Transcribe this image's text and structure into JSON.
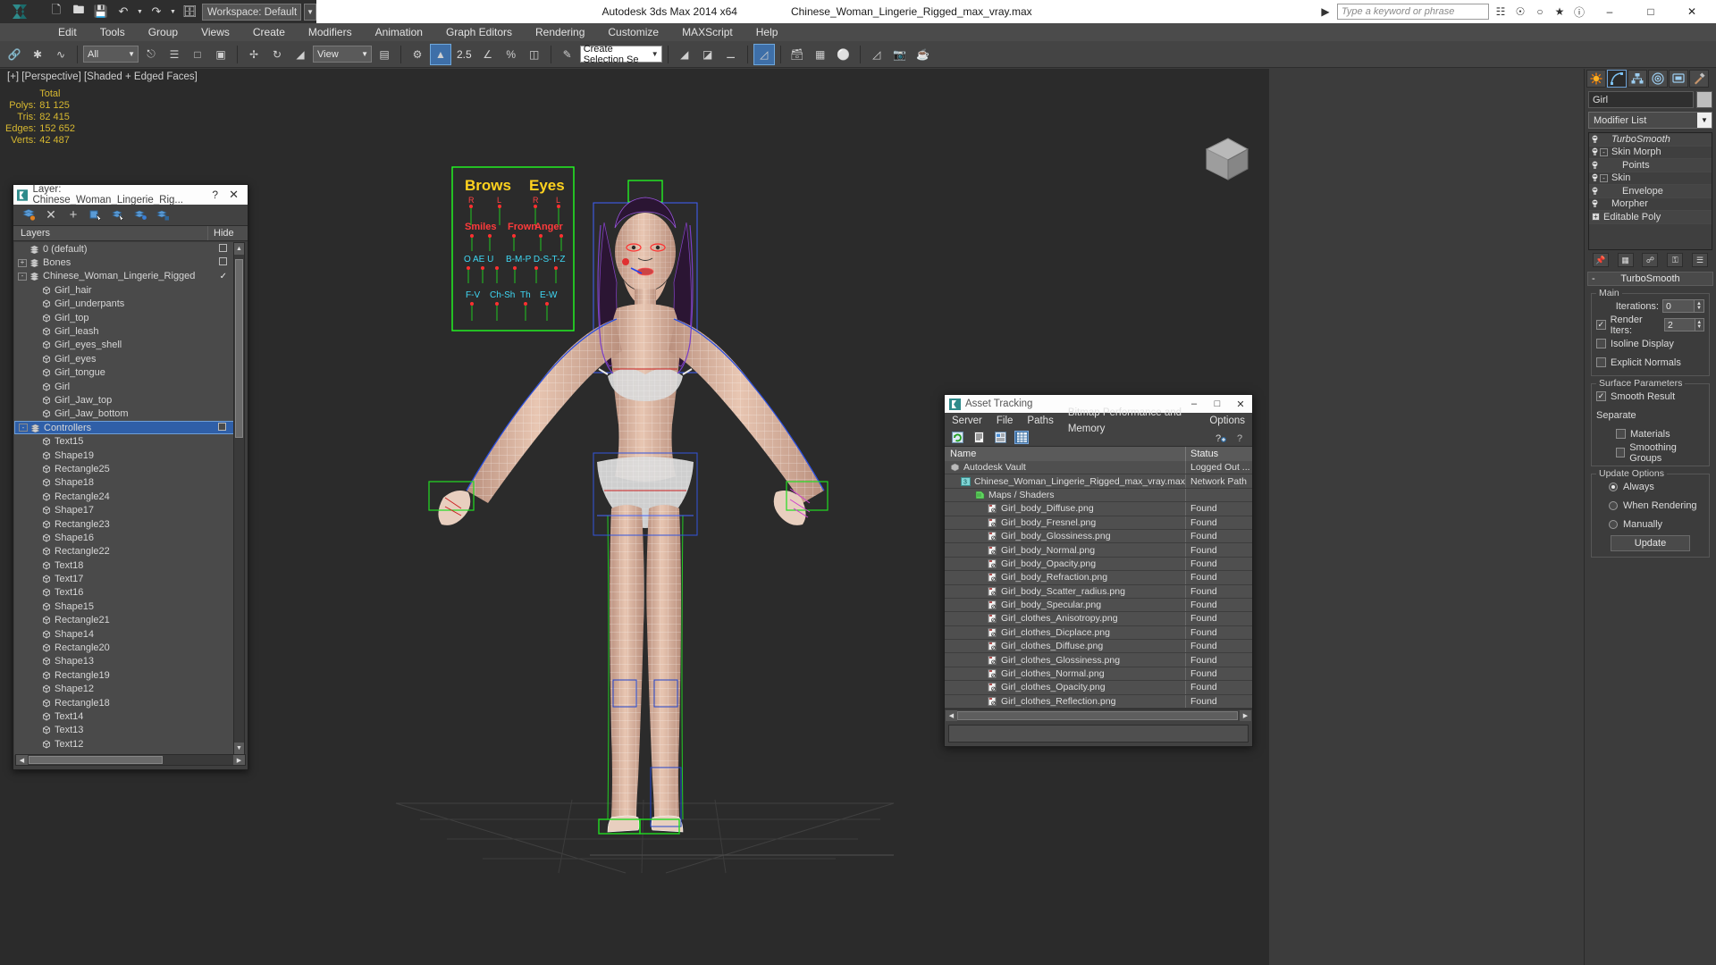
{
  "titlebar": {
    "app_title": "Autodesk 3ds Max  2014 x64",
    "file_title": "Chinese_Woman_Lingerie_Rigged_max_vray.max",
    "workspace": "Workspace: Default",
    "search_placeholder": "Type a keyword or phrase",
    "quick_icons": [
      "new-icon",
      "open-icon",
      "save-icon",
      "undo-icon",
      "redo-icon",
      "set-project-icon"
    ],
    "window_buttons": [
      "minimize",
      "maximize",
      "close"
    ]
  },
  "menubar": {
    "items": [
      "Edit",
      "Tools",
      "Group",
      "Views",
      "Create",
      "Modifiers",
      "Animation",
      "Graph Editors",
      "Rendering",
      "Customize",
      "MAXScript",
      "Help"
    ]
  },
  "toolbar": {
    "selection_filter": "All",
    "reference_coord": "View",
    "named_selection_set": "Create Selection Se",
    "angle_snap_value": "2.5"
  },
  "viewport": {
    "label": "[+] [Perspective] [Shaded + Edged Faces]",
    "stats": {
      "header": "Total",
      "rows": [
        {
          "label": "Polys:",
          "value": "81 125"
        },
        {
          "label": "Tris:",
          "value": "82 415"
        },
        {
          "label": "Edges:",
          "value": "152 652"
        },
        {
          "label": "Verts:",
          "value": "42 487"
        }
      ]
    },
    "overlay_labels": {
      "brows": "Brows",
      "eyes": "Eyes",
      "smiles": "Smiles",
      "frown": "Frown",
      "anger": "Anger",
      "left_short": "L",
      "right_short": "R",
      "row3": "O  AE  U",
      "row3b": "B-M-P  D-S-T-Z",
      "row4": "F-V",
      "row4b": "Ch-Sh",
      "row4c": "Th",
      "row4d": "E-W"
    }
  },
  "layer_dialog": {
    "title": "Layer: Chinese_Woman_Lingerie_Rig...",
    "help_label": "?",
    "close_label": "✕",
    "toolbar_icons": [
      "new-layer-icon",
      "delete-layer-icon",
      "add-layer-icon",
      "select-objects-icon",
      "select-highlighted-icon",
      "add-selection-icon",
      "layer-properties-icon"
    ],
    "columns": {
      "name": "Layers",
      "hide": "Hide"
    },
    "rows": [
      {
        "label": "0 (default)",
        "indent": 1,
        "icon": "layer-icon",
        "expander": null,
        "hide": "box",
        "selected": false
      },
      {
        "label": "Bones",
        "indent": 1,
        "icon": "layer-icon",
        "expander": "+",
        "hide": "box",
        "selected": false
      },
      {
        "label": "Chinese_Woman_Lingerie_Rigged",
        "indent": 1,
        "icon": "layer-icon",
        "expander": "-",
        "hide": "check",
        "selected": false
      },
      {
        "label": "Girl_hair",
        "indent": 2,
        "icon": "object-icon",
        "expander": null,
        "hide": "",
        "selected": false
      },
      {
        "label": "Girl_underpants",
        "indent": 2,
        "icon": "object-icon",
        "expander": null,
        "hide": "",
        "selected": false
      },
      {
        "label": "Girl_top",
        "indent": 2,
        "icon": "object-icon",
        "expander": null,
        "hide": "",
        "selected": false
      },
      {
        "label": "Girl_leash",
        "indent": 2,
        "icon": "object-icon",
        "expander": null,
        "hide": "",
        "selected": false
      },
      {
        "label": "Girl_eyes_shell",
        "indent": 2,
        "icon": "object-icon",
        "expander": null,
        "hide": "",
        "selected": false
      },
      {
        "label": "Girl_eyes",
        "indent": 2,
        "icon": "object-icon",
        "expander": null,
        "hide": "",
        "selected": false
      },
      {
        "label": "Girl_tongue",
        "indent": 2,
        "icon": "object-icon",
        "expander": null,
        "hide": "",
        "selected": false
      },
      {
        "label": "Girl",
        "indent": 2,
        "icon": "object-icon",
        "expander": null,
        "hide": "",
        "selected": false
      },
      {
        "label": "Girl_Jaw_top",
        "indent": 2,
        "icon": "object-icon",
        "expander": null,
        "hide": "",
        "selected": false
      },
      {
        "label": "Girl_Jaw_bottom",
        "indent": 2,
        "icon": "object-icon",
        "expander": null,
        "hide": "",
        "selected": false
      },
      {
        "label": "Controllers",
        "indent": 1,
        "icon": "layer-icon",
        "expander": "-",
        "hide": "box",
        "selected": true
      },
      {
        "label": "Text15",
        "indent": 2,
        "icon": "object-icon",
        "expander": null,
        "hide": "",
        "selected": false
      },
      {
        "label": "Shape19",
        "indent": 2,
        "icon": "object-icon",
        "expander": null,
        "hide": "",
        "selected": false
      },
      {
        "label": "Rectangle25",
        "indent": 2,
        "icon": "object-icon",
        "expander": null,
        "hide": "",
        "selected": false
      },
      {
        "label": "Shape18",
        "indent": 2,
        "icon": "object-icon",
        "expander": null,
        "hide": "",
        "selected": false
      },
      {
        "label": "Rectangle24",
        "indent": 2,
        "icon": "object-icon",
        "expander": null,
        "hide": "",
        "selected": false
      },
      {
        "label": "Shape17",
        "indent": 2,
        "icon": "object-icon",
        "expander": null,
        "hide": "",
        "selected": false
      },
      {
        "label": "Rectangle23",
        "indent": 2,
        "icon": "object-icon",
        "expander": null,
        "hide": "",
        "selected": false
      },
      {
        "label": "Shape16",
        "indent": 2,
        "icon": "object-icon",
        "expander": null,
        "hide": "",
        "selected": false
      },
      {
        "label": "Rectangle22",
        "indent": 2,
        "icon": "object-icon",
        "expander": null,
        "hide": "",
        "selected": false
      },
      {
        "label": "Text18",
        "indent": 2,
        "icon": "object-icon",
        "expander": null,
        "hide": "",
        "selected": false
      },
      {
        "label": "Text17",
        "indent": 2,
        "icon": "object-icon",
        "expander": null,
        "hide": "",
        "selected": false
      },
      {
        "label": "Text16",
        "indent": 2,
        "icon": "object-icon",
        "expander": null,
        "hide": "",
        "selected": false
      },
      {
        "label": "Shape15",
        "indent": 2,
        "icon": "object-icon",
        "expander": null,
        "hide": "",
        "selected": false
      },
      {
        "label": "Rectangle21",
        "indent": 2,
        "icon": "object-icon",
        "expander": null,
        "hide": "",
        "selected": false
      },
      {
        "label": "Shape14",
        "indent": 2,
        "icon": "object-icon",
        "expander": null,
        "hide": "",
        "selected": false
      },
      {
        "label": "Rectangle20",
        "indent": 2,
        "icon": "object-icon",
        "expander": null,
        "hide": "",
        "selected": false
      },
      {
        "label": "Shape13",
        "indent": 2,
        "icon": "object-icon",
        "expander": null,
        "hide": "",
        "selected": false
      },
      {
        "label": "Rectangle19",
        "indent": 2,
        "icon": "object-icon",
        "expander": null,
        "hide": "",
        "selected": false
      },
      {
        "label": "Shape12",
        "indent": 2,
        "icon": "object-icon",
        "expander": null,
        "hide": "",
        "selected": false
      },
      {
        "label": "Rectangle18",
        "indent": 2,
        "icon": "object-icon",
        "expander": null,
        "hide": "",
        "selected": false
      },
      {
        "label": "Text14",
        "indent": 2,
        "icon": "object-icon",
        "expander": null,
        "hide": "",
        "selected": false
      },
      {
        "label": "Text13",
        "indent": 2,
        "icon": "object-icon",
        "expander": null,
        "hide": "",
        "selected": false
      },
      {
        "label": "Text12",
        "indent": 2,
        "icon": "object-icon",
        "expander": null,
        "hide": "",
        "selected": false
      }
    ]
  },
  "asset_tracking": {
    "title": "Asset Tracking",
    "menu": [
      "Server",
      "File",
      "Paths",
      "Bitmap Performance and Memory",
      "Options"
    ],
    "toolbar_icons": [
      "refresh-icon",
      "list-view-icon",
      "detail-view-icon",
      "grid-view-icon",
      "add-help-icon",
      "help-icon"
    ],
    "columns": {
      "name": "Name",
      "status": "Status"
    },
    "rows": [
      {
        "name": "Autodesk Vault",
        "status": "Logged Out ...",
        "indent": 1,
        "icon": "vault-icon"
      },
      {
        "name": "Chinese_Woman_Lingerie_Rigged_max_vray.max",
        "status": "Network Path",
        "indent": 2,
        "icon": "max-file-icon"
      },
      {
        "name": "Maps / Shaders",
        "status": "",
        "indent": 3,
        "icon": "maps-icon"
      },
      {
        "name": "Girl_body_Diffuse.png",
        "status": "Found",
        "indent": 4,
        "icon": "bitmap-icon"
      },
      {
        "name": "Girl_body_Fresnel.png",
        "status": "Found",
        "indent": 4,
        "icon": "bitmap-icon"
      },
      {
        "name": "Girl_body_Glossiness.png",
        "status": "Found",
        "indent": 4,
        "icon": "bitmap-icon"
      },
      {
        "name": "Girl_body_Normal.png",
        "status": "Found",
        "indent": 4,
        "icon": "bitmap-icon"
      },
      {
        "name": "Girl_body_Opacity.png",
        "status": "Found",
        "indent": 4,
        "icon": "bitmap-icon"
      },
      {
        "name": "Girl_body_Refraction.png",
        "status": "Found",
        "indent": 4,
        "icon": "bitmap-icon"
      },
      {
        "name": "Girl_body_Scatter_radius.png",
        "status": "Found",
        "indent": 4,
        "icon": "bitmap-icon"
      },
      {
        "name": "Girl_body_Specular.png",
        "status": "Found",
        "indent": 4,
        "icon": "bitmap-icon"
      },
      {
        "name": "Girl_clothes_Anisotropy.png",
        "status": "Found",
        "indent": 4,
        "icon": "bitmap-icon"
      },
      {
        "name": "Girl_clothes_Dicplace.png",
        "status": "Found",
        "indent": 4,
        "icon": "bitmap-icon"
      },
      {
        "name": "Girl_clothes_Diffuse.png",
        "status": "Found",
        "indent": 4,
        "icon": "bitmap-icon"
      },
      {
        "name": "Girl_clothes_Glossiness.png",
        "status": "Found",
        "indent": 4,
        "icon": "bitmap-icon"
      },
      {
        "name": "Girl_clothes_Normal.png",
        "status": "Found",
        "indent": 4,
        "icon": "bitmap-icon"
      },
      {
        "name": "Girl_clothes_Opacity.png",
        "status": "Found",
        "indent": 4,
        "icon": "bitmap-icon"
      },
      {
        "name": "Girl_clothes_Reflection.png",
        "status": "Found",
        "indent": 4,
        "icon": "bitmap-icon"
      }
    ]
  },
  "command_panel": {
    "tabs": [
      "create-tab",
      "modify-tab",
      "hierarchy-tab",
      "motion-tab",
      "display-tab",
      "utilities-tab"
    ],
    "active_tab_index": 1,
    "object_name": "Girl",
    "modifier_list_label": "Modifier List",
    "stack": [
      {
        "label": "TurboSmooth",
        "italic": true,
        "expander": null,
        "indent": 1
      },
      {
        "label": "Skin Morph",
        "italic": false,
        "expander": "-",
        "indent": 1
      },
      {
        "label": "Points",
        "italic": false,
        "expander": null,
        "indent": 2
      },
      {
        "label": "Skin",
        "italic": false,
        "expander": "-",
        "indent": 1
      },
      {
        "label": "Envelope",
        "italic": false,
        "expander": null,
        "indent": 2
      },
      {
        "label": "Morpher",
        "italic": false,
        "expander": null,
        "indent": 1
      },
      {
        "label": "Editable Poly",
        "italic": false,
        "expander": "+",
        "indent": 0
      }
    ],
    "rollout": {
      "title": "TurboSmooth",
      "minus": "-",
      "main_group": "Main",
      "iterations_label": "Iterations:",
      "iterations_value": "0",
      "render_iters_label": "Render Iters:",
      "render_iters_value": "2",
      "render_iters_checked": true,
      "isoline_label": "Isoline Display",
      "isoline_checked": false,
      "explicit_normals_label": "Explicit Normals",
      "explicit_normals_checked": false,
      "surface_group": "Surface Parameters",
      "smooth_result_label": "Smooth Result",
      "smooth_result_checked": true,
      "separate_label": "Separate",
      "materials_label": "Materials",
      "materials_checked": false,
      "smoothing_groups_label": "Smoothing Groups",
      "smoothing_groups_checked": false,
      "update_group": "Update Options",
      "update_options": [
        "Always",
        "When Rendering",
        "Manually"
      ],
      "update_selected": 0,
      "update_button": "Update"
    }
  },
  "colors": {
    "accent_blue": "#3e6fa8",
    "stats_yellow": "#d7b830",
    "panel_bg": "#3c3c3c",
    "viewport_bg": "#2b2b2b",
    "selection_blue": "#2f5fa8"
  }
}
